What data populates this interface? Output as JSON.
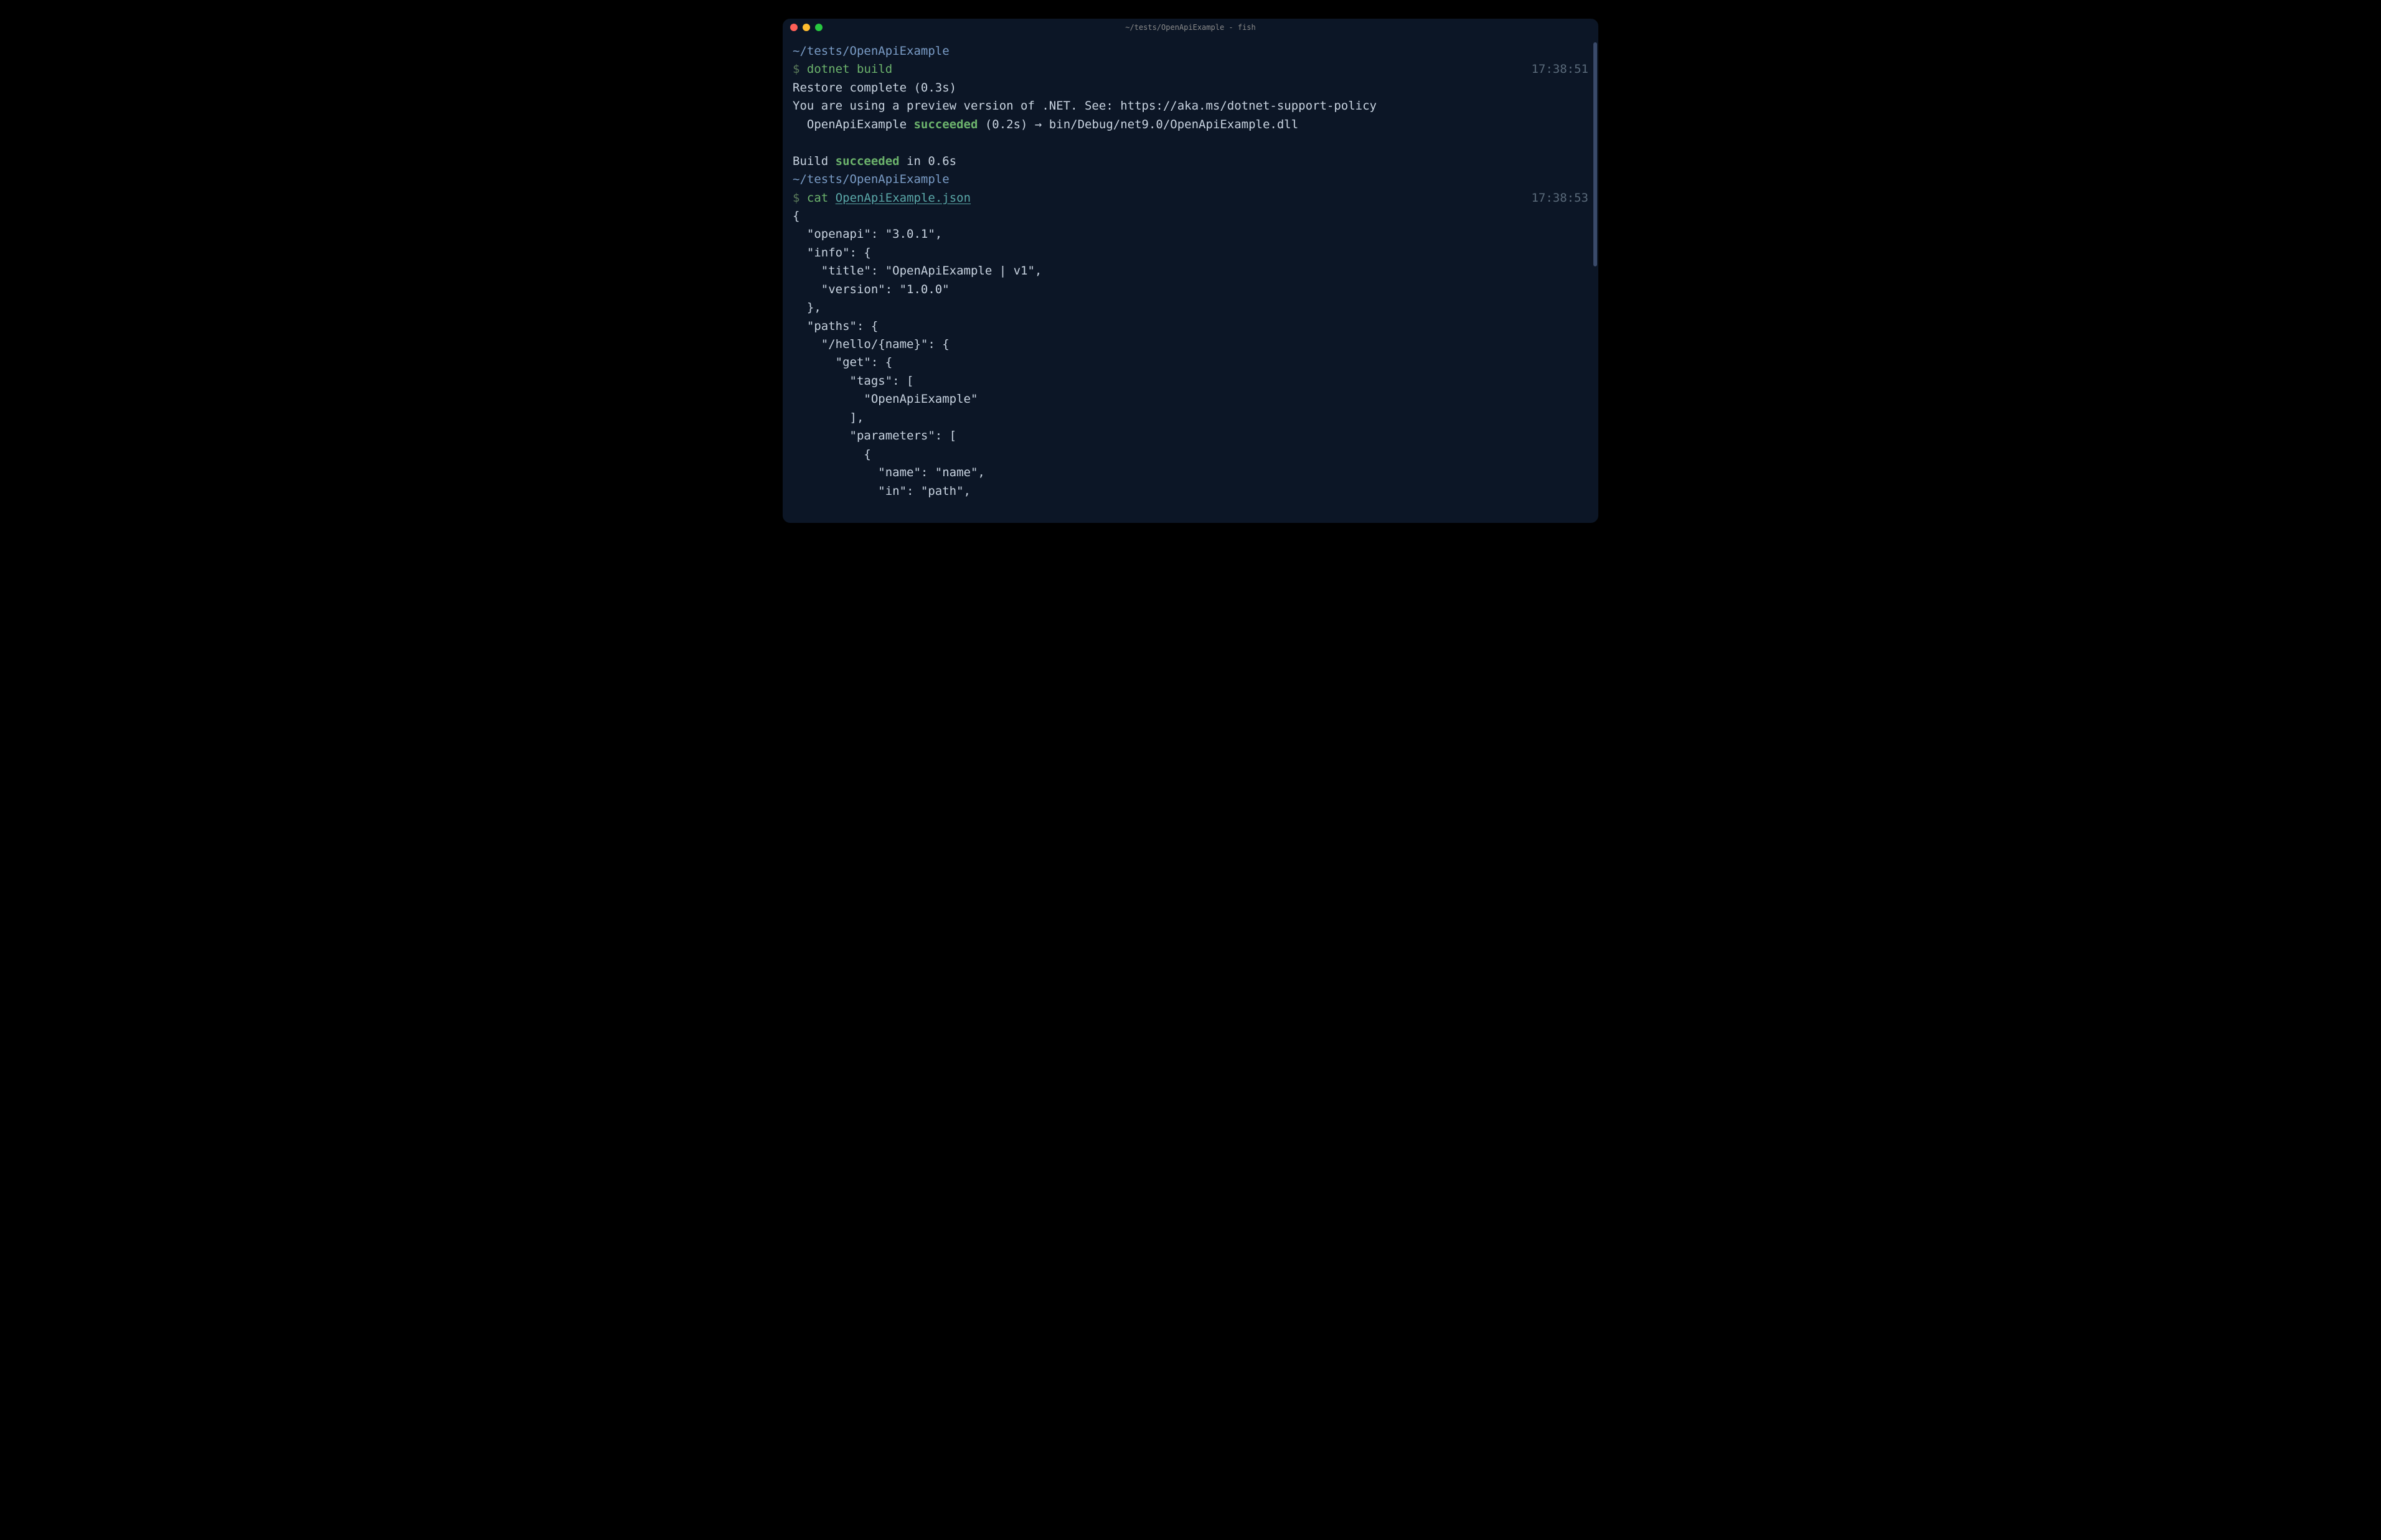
{
  "window": {
    "title": "~/tests/OpenApiExample - fish"
  },
  "colors": {
    "bg": "#0c1626",
    "cwd": "#7a9cc6",
    "cmd": "#6cb36c",
    "succeeded": "#6cb36c",
    "link": "#5aa8a8",
    "timestamp": "#5a6a7a",
    "text": "#c8d3e0"
  },
  "session": {
    "cwd1": "~/tests/OpenApiExample",
    "prompt1": {
      "symbol": "$",
      "command": "dotnet",
      "args": "build",
      "time": "17:38:51"
    },
    "output1": {
      "line1": "Restore complete (0.3s)",
      "line2": "You are using a preview version of .NET. See: https://aka.ms/dotnet-support-policy",
      "line3_prefix": "  OpenApiExample ",
      "line3_status": "succeeded",
      "line3_suffix": " (0.2s) → bin/Debug/net9.0/OpenApiExample.dll",
      "line4_prefix": "Build ",
      "line4_status": "succeeded",
      "line4_suffix": " in 0.6s"
    },
    "cwd2": "~/tests/OpenApiExample",
    "prompt2": {
      "symbol": "$",
      "command": "cat",
      "filename": "OpenApiExample.json",
      "time": "17:38:53"
    },
    "json_lines": [
      "{",
      "  \"openapi\": \"3.0.1\",",
      "  \"info\": {",
      "    \"title\": \"OpenApiExample | v1\",",
      "    \"version\": \"1.0.0\"",
      "  },",
      "  \"paths\": {",
      "    \"/hello/{name}\": {",
      "      \"get\": {",
      "        \"tags\": [",
      "          \"OpenApiExample\"",
      "        ],",
      "        \"parameters\": [",
      "          {",
      "            \"name\": \"name\",",
      "            \"in\": \"path\","
    ]
  }
}
